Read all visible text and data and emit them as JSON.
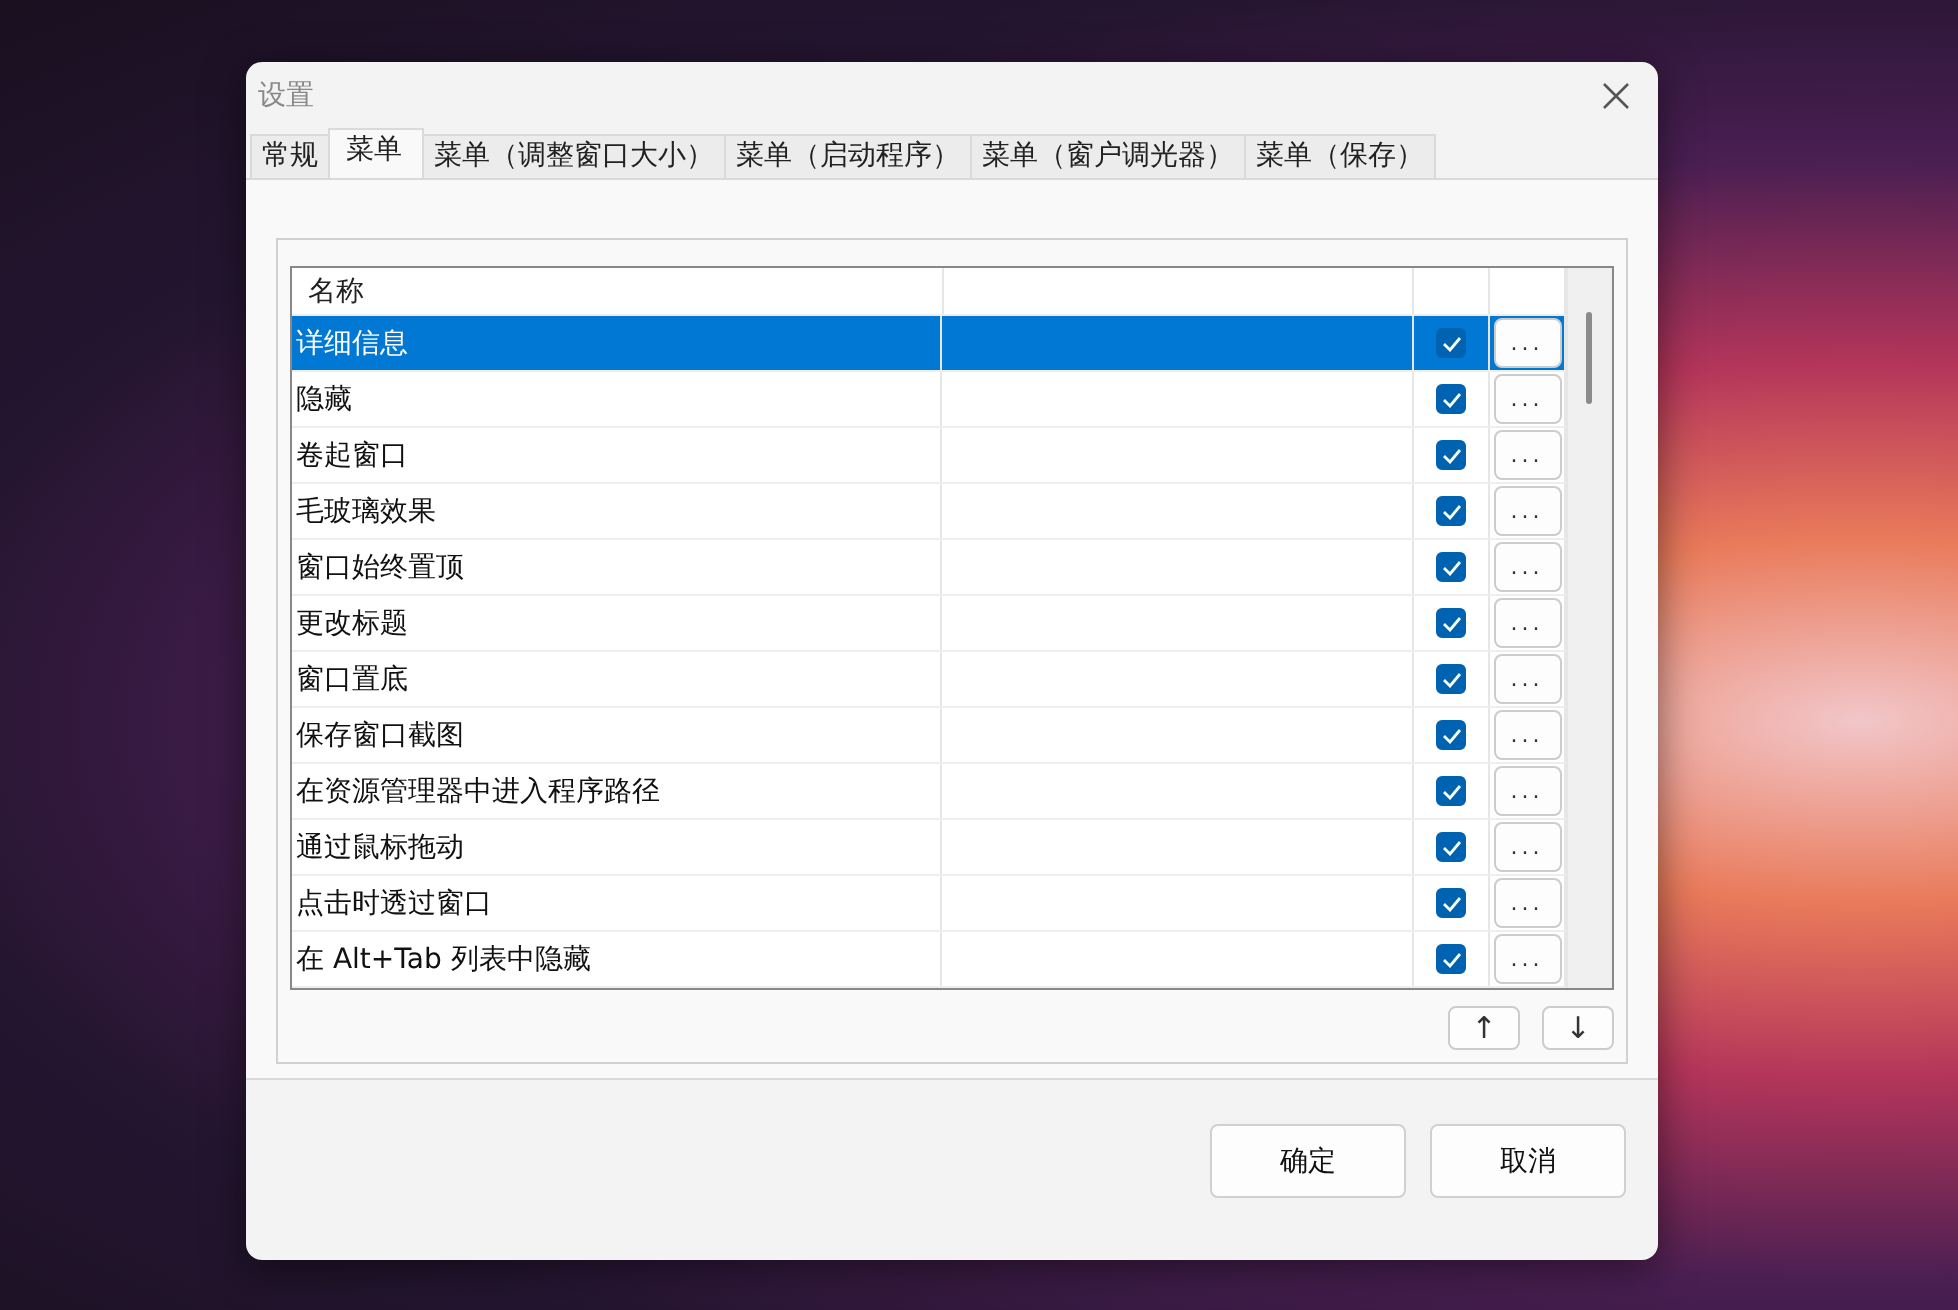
{
  "window": {
    "title": "设置"
  },
  "tabs": [
    {
      "label": "常规",
      "selected": false
    },
    {
      "label": "菜单",
      "selected": true
    },
    {
      "label": "菜单（调整窗口大小）",
      "selected": false
    },
    {
      "label": "菜单（启动程序）",
      "selected": false
    },
    {
      "label": "菜单（窗户调光器）",
      "selected": false
    },
    {
      "label": "菜单（保存）",
      "selected": false
    }
  ],
  "table": {
    "columns": [
      "名称"
    ],
    "rows": [
      {
        "name": "详细信息",
        "checked": true,
        "selected": true,
        "button": "..."
      },
      {
        "name": "隐藏",
        "checked": true,
        "selected": false,
        "button": "..."
      },
      {
        "name": "卷起窗口",
        "checked": true,
        "selected": false,
        "button": "..."
      },
      {
        "name": "毛玻璃效果",
        "checked": true,
        "selected": false,
        "button": "..."
      },
      {
        "name": "窗口始终置顶",
        "checked": true,
        "selected": false,
        "button": "..."
      },
      {
        "name": "更改标题",
        "checked": true,
        "selected": false,
        "button": "..."
      },
      {
        "name": "窗口置底",
        "checked": true,
        "selected": false,
        "button": "..."
      },
      {
        "name": "保存窗口截图",
        "checked": true,
        "selected": false,
        "button": "..."
      },
      {
        "name": "在资源管理器中进入程序路径",
        "checked": true,
        "selected": false,
        "button": "..."
      },
      {
        "name": "通过鼠标拖动",
        "checked": true,
        "selected": false,
        "button": "..."
      },
      {
        "name": "点击时透过窗口",
        "checked": true,
        "selected": false,
        "button": "..."
      },
      {
        "name": "在 Alt+Tab 列表中隐藏",
        "checked": true,
        "selected": false,
        "button": "..."
      }
    ]
  },
  "move_buttons": [
    "↑",
    "↓"
  ],
  "buttons": [
    "确定",
    "取消"
  ]
}
